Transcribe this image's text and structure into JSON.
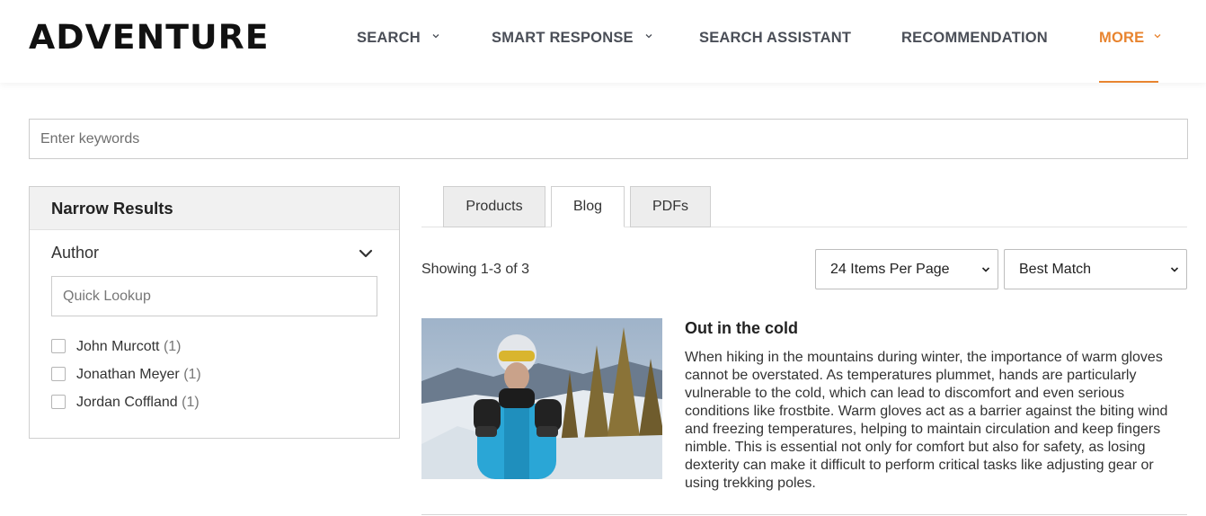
{
  "brand": {
    "logo_text": "ADVENTURE",
    "accent_color": "#e8842f"
  },
  "nav": {
    "items": [
      {
        "label": "SEARCH",
        "has_dropdown": true
      },
      {
        "label": "SMART RESPONSE",
        "has_dropdown": true
      },
      {
        "label": "SEARCH ASSISTANT",
        "has_dropdown": false
      },
      {
        "label": "RECOMMENDATION",
        "has_dropdown": false
      },
      {
        "label": "MORE",
        "has_dropdown": true,
        "active": true
      }
    ]
  },
  "search": {
    "placeholder": "Enter keywords",
    "value": ""
  },
  "sidebar": {
    "title": "Narrow Results",
    "facet": {
      "title": "Author",
      "lookup_placeholder": "Quick Lookup",
      "options": [
        {
          "label": "John Murcott",
          "count": "(1)",
          "checked": false
        },
        {
          "label": "Jonathan Meyer",
          "count": "(1)",
          "checked": false
        },
        {
          "label": "Jordan Coffland",
          "count": "(1)",
          "checked": false
        }
      ]
    }
  },
  "tabs": [
    {
      "label": "Products",
      "active": false
    },
    {
      "label": "Blog",
      "active": true
    },
    {
      "label": "PDFs",
      "active": false
    }
  ],
  "results_toolbar": {
    "showing": "Showing 1-3 of 3",
    "per_page": "24 Items Per Page",
    "sort": "Best Match"
  },
  "results": [
    {
      "title": "Out in the cold",
      "description": "When hiking in the mountains during winter, the importance of warm gloves cannot be overstated. As temperatures plummet, hands are particularly vulnerable to the cold, which can lead to discomfort and even serious conditions like frostbite. Warm gloves act as a barrier against the biting wind and freezing temperatures, helping to maintain circulation and keep fingers nimble. This is essential not only for comfort but also for safety, as losing dexterity can make it difficult to perform critical tasks like adjusting gear or using trekking poles."
    }
  ]
}
